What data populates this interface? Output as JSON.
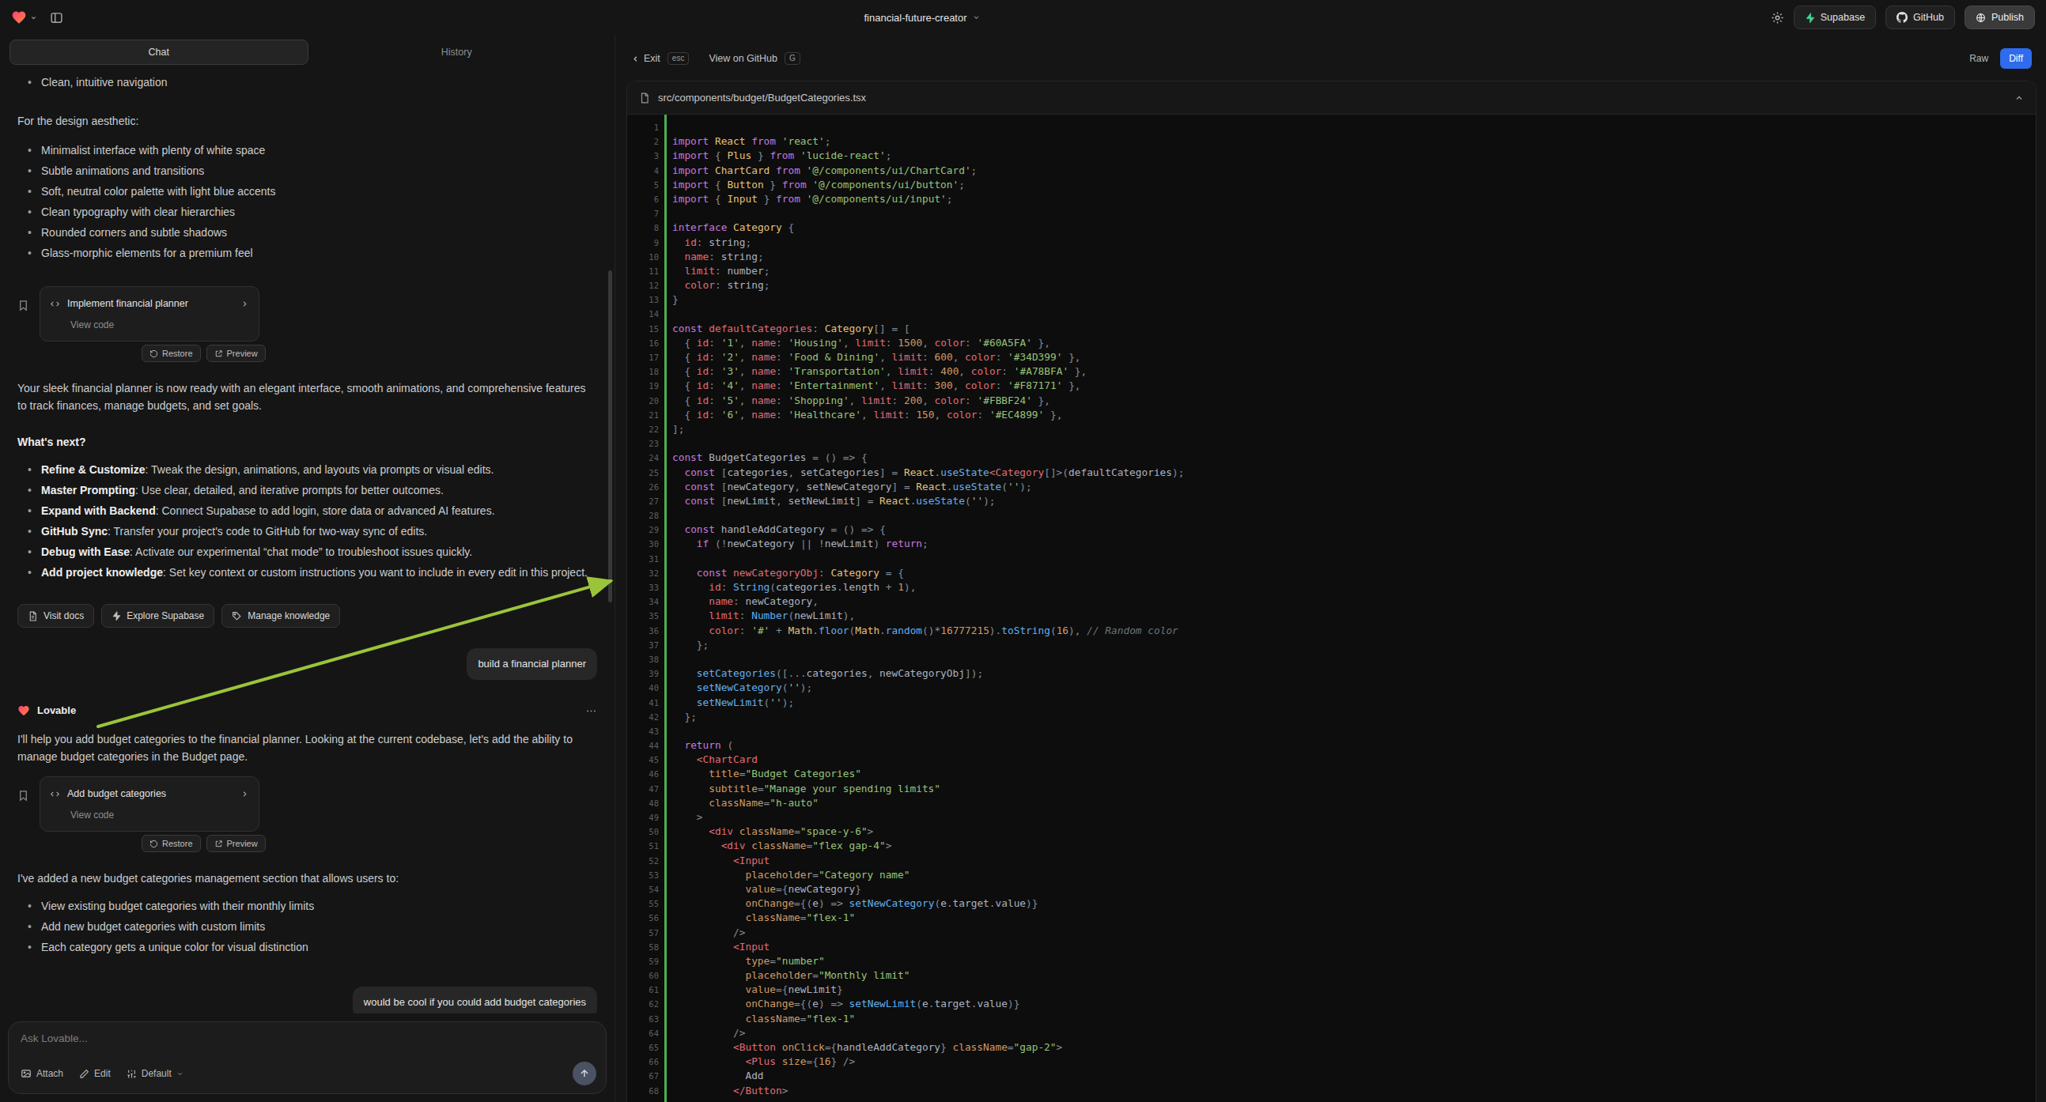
{
  "topbar": {
    "project_name": "financial-future-creator",
    "buttons": {
      "supabase": "Supabase",
      "github": "GitHub",
      "publish": "Publish"
    }
  },
  "chat_panel": {
    "tabs": {
      "chat": "Chat",
      "history": "History"
    },
    "messages": {
      "scrolled_bullet": "Clean, intuitive navigation",
      "design_intro": "For the design aesthetic:",
      "design_points": [
        "Minimalist interface with plenty of white space",
        "Subtle animations and transitions",
        "Soft, neutral color palette with light blue accents",
        "Clean typography with clear hierarchies",
        "Rounded corners and subtle shadows",
        "Glass-morphic elements for a premium feel"
      ],
      "tool_card_1": {
        "title": "Implement financial planner",
        "subtitle": "View code",
        "restore_label": "Restore",
        "preview_label": "Preview"
      },
      "ready_paragraph": "Your sleek financial planner is now ready with an elegant interface, smooth animations, and comprehensive features to track finances, manage budgets, and set goals.",
      "whats_next_heading": "What's next?",
      "next_steps": [
        {
          "lead": "Refine & Customize",
          "text": ": Tweak the design, animations, and layouts via prompts or visual edits."
        },
        {
          "lead": "Master Prompting",
          "text": ": Use clear, detailed, and iterative prompts for better outcomes."
        },
        {
          "lead": "Expand with Backend",
          "text": ": Connect Supabase to add login, store data or advanced AI features."
        },
        {
          "lead": "GitHub Sync",
          "text": ": Transfer your project's code to GitHub for two-way sync of edits."
        },
        {
          "lead": "Debug with Ease",
          "text": ": Activate our experimental “chat mode” to troubleshoot issues quickly."
        },
        {
          "lead": "Add project knowledge",
          "text": ": Set key context or custom instructions you want to include in every edit in this project."
        }
      ],
      "quick_actions": {
        "visit_docs": "Visit docs",
        "explore_supabase": "Explore Supabase",
        "manage_knowledge": "Manage knowledge"
      },
      "user_message_1": "build a financial planner",
      "assistant_name": "Lovable",
      "assistant_intro": "I'll help you add budget categories to the financial planner. Looking at the current codebase, let's add the ability to manage budget categories in the Budget page.",
      "tool_card_2": {
        "title": "Add budget categories",
        "subtitle": "View code",
        "restore_label": "Restore",
        "preview_label": "Preview"
      },
      "added_paragraph": "I've added a new budget categories management section that allows users to:",
      "added_points": [
        "View existing budget categories with their monthly limits",
        "Add new budget categories with custom limits",
        "Each category gets a unique color for visual distinction"
      ],
      "user_message_2": "would be cool if you could add budget categories"
    },
    "composer": {
      "placeholder": "Ask Lovable...",
      "attach_label": "Attach",
      "edit_label": "Edit",
      "mode_label": "Default"
    }
  },
  "code_panel": {
    "toolbar": {
      "exit_label": "Exit",
      "esc_badge": "esc",
      "github_label": "View on GitHub",
      "github_badge": "G",
      "raw_label": "Raw",
      "diff_label": "Diff"
    },
    "file_path": "src/components/budget/BudgetCategories.tsx",
    "code_lines": [
      "",
      "import React from 'react';",
      "import { Plus } from 'lucide-react';",
      "import ChartCard from '@/components/ui/ChartCard';",
      "import { Button } from '@/components/ui/button';",
      "import { Input } from '@/components/ui/input';",
      "",
      "interface Category {",
      "  id: string;",
      "  name: string;",
      "  limit: number;",
      "  color: string;",
      "}",
      "",
      "const defaultCategories: Category[] = [",
      "  { id: '1', name: 'Housing', limit: 1500, color: '#60A5FA' },",
      "  { id: '2', name: 'Food & Dining', limit: 600, color: '#34D399' },",
      "  { id: '3', name: 'Transportation', limit: 400, color: '#A78BFA' },",
      "  { id: '4', name: 'Entertainment', limit: 300, color: '#F87171' },",
      "  { id: '5', name: 'Shopping', limit: 200, color: '#FBBF24' },",
      "  { id: '6', name: 'Healthcare', limit: 150, color: '#EC4899' },",
      "];",
      "",
      "const BudgetCategories = () => {",
      "  const [categories, setCategories] = React.useState<Category[]>(defaultCategories);",
      "  const [newCategory, setNewCategory] = React.useState('');",
      "  const [newLimit, setNewLimit] = React.useState('');",
      "",
      "  const handleAddCategory = () => {",
      "    if (!newCategory || !newLimit) return;",
      "",
      "    const newCategoryObj: Category = {",
      "      id: String(categories.length + 1),",
      "      name: newCategory,",
      "      limit: Number(newLimit),",
      "      color: '#' + Math.floor(Math.random()*16777215).toString(16), // Random color",
      "    };",
      "",
      "    setCategories([...categories, newCategoryObj]);",
      "    setNewCategory('');",
      "    setNewLimit('');",
      "  };",
      "",
      "  return (",
      "    <ChartCard",
      "      title=\"Budget Categories\"",
      "      subtitle=\"Manage your spending limits\"",
      "      className=\"h-auto\"",
      "    >",
      "      <div className=\"space-y-6\">",
      "        <div className=\"flex gap-4\">",
      "          <Input",
      "            placeholder=\"Category name\"",
      "            value={newCategory}",
      "            onChange={(e) => setNewCategory(e.target.value)}",
      "            className=\"flex-1\"",
      "          />",
      "          <Input",
      "            type=\"number\"",
      "            placeholder=\"Monthly limit\"",
      "            value={newLimit}",
      "            onChange={(e) => setNewLimit(e.target.value)}",
      "            className=\"flex-1\"",
      "          />",
      "          <Button onClick={handleAddCategory} className=\"gap-2\">",
      "            <Plus size={16} />",
      "            Add",
      "          </Button>"
    ]
  },
  "colors": {
    "diff_button_blue": "#2f6bed",
    "diff_added_green": "#4caf50",
    "supabase_green": "#3ecf8e",
    "annotation_arrow_green": "#9cc43b",
    "lovable_gradient_start": "#ff3d77",
    "lovable_gradient_end": "#ff8a3d"
  }
}
